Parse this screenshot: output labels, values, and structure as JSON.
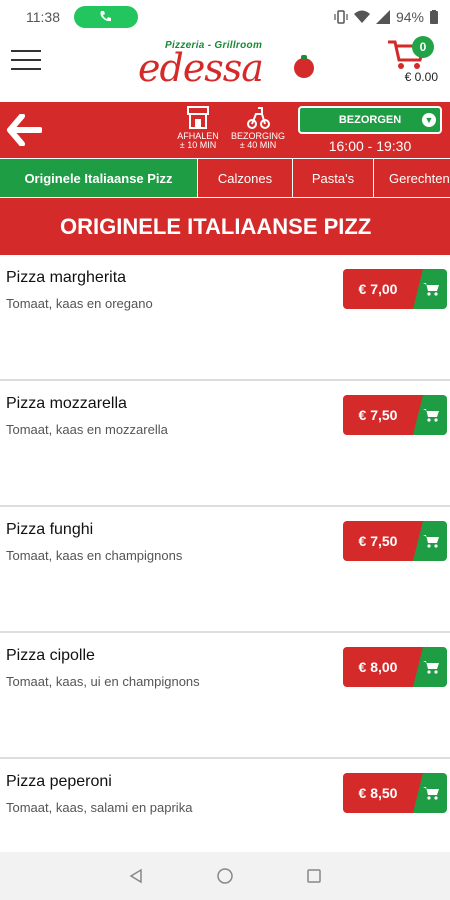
{
  "status_bar": {
    "time": "11:38",
    "battery": "94%"
  },
  "header": {
    "brand_sub": "Pizzeria - Grillroom",
    "brand_main": "edessa",
    "cart_count": "0",
    "cart_total": "€ 0.00"
  },
  "order_bar": {
    "pickup_label": "AFHALEN",
    "pickup_time": "± 10 MIN",
    "delivery_label": "BEZORGING",
    "delivery_time": "± 40 MIN",
    "mode_button": "BEZORGEN",
    "hours": "16:00 - 19:30"
  },
  "tabs": [
    {
      "label": "Originele Italiaanse Pizz",
      "active": true
    },
    {
      "label": "Calzones"
    },
    {
      "label": "Pasta's"
    },
    {
      "label": "Gerechten"
    }
  ],
  "section_title": "ORIGINELE ITALIAANSE PIZZ",
  "items": [
    {
      "name": "Pizza margherita",
      "desc": "Tomaat, kaas en oregano",
      "price": "€ 7,00"
    },
    {
      "name": "Pizza mozzarella",
      "desc": "Tomaat, kaas en mozzarella",
      "price": "€ 7,50"
    },
    {
      "name": "Pizza funghi",
      "desc": "Tomaat, kaas en champignons",
      "price": "€ 7,50"
    },
    {
      "name": "Pizza cipolle",
      "desc": "Tomaat, kaas, ui en champignons",
      "price": "€ 8,00"
    },
    {
      "name": "Pizza peperoni",
      "desc": "Tomaat, kaas, salami en paprika",
      "price": "€ 8,50"
    }
  ],
  "colors": {
    "red": "#d42a2a",
    "green": "#1f9d45"
  }
}
